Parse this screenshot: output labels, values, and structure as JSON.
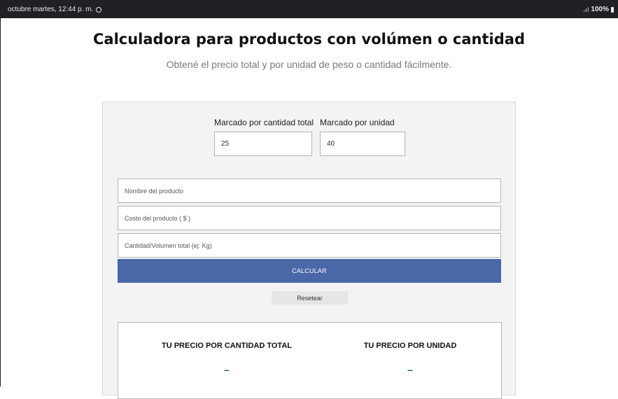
{
  "status_bar": {
    "datetime": "octubre martes, 12:44 p. m.",
    "battery": "100%",
    "icons": [
      "whatsapp-icon",
      "signal-icon",
      "battery-icon"
    ]
  },
  "page": {
    "title": "Calculadora para productos con volúmen o cantidad",
    "subtitle": "Obtené el precio total y por unidad de peso o cantidad fácilmente."
  },
  "markup": {
    "total_label": "Marcado por cantidad total",
    "total_value": "25",
    "unit_label": "Marcado por unidad",
    "unit_value": "40"
  },
  "form": {
    "product_name_placeholder": "Nombre del producto",
    "product_cost_placeholder": "Costo del producto ( $ )",
    "quantity_placeholder": "Cantidad/Volumen total (ej: Kg)",
    "calculate_label": "CALCULAR",
    "reset_label": "Resetear"
  },
  "results": {
    "total_heading": "TU PRECIO POR CANTIDAD TOTAL",
    "total_value": "–",
    "unit_heading": "TU PRECIO POR UNIDAD",
    "unit_value": "–"
  },
  "colors": {
    "status_bar": "#202124",
    "button": "#4a67a8",
    "result_value": "#1a6b1a",
    "card_background": "#f3f3f3"
  }
}
